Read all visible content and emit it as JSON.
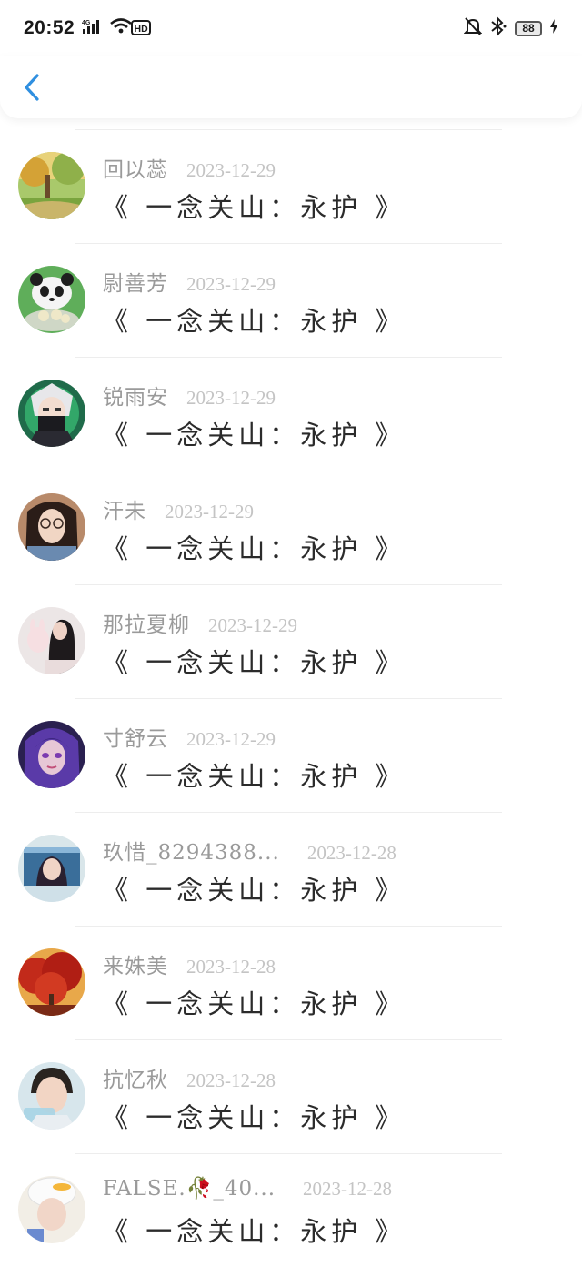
{
  "status_bar": {
    "time": "20:52",
    "network": "4G",
    "hd": "HD",
    "battery": "88"
  },
  "header": {
    "back_icon": "chevron-left-icon",
    "accent_color": "#2f8fe0"
  },
  "list": {
    "items": [
      {
        "name": "回以蕊",
        "date": "2023-12-29",
        "title": "《 一念关山：永护 》",
        "avatar": "landscape-avatar"
      },
      {
        "name": "尉善芳",
        "date": "2023-12-29",
        "title": "《 一念关山：永护 》",
        "avatar": "panda-avatar"
      },
      {
        "name": "锐雨安",
        "date": "2023-12-29",
        "title": "《 一念关山：永护 》",
        "avatar": "masked-ninja-avatar"
      },
      {
        "name": "汗未",
        "date": "2023-12-29",
        "title": "《 一念关山：永护 》",
        "avatar": "girl-glasses-avatar"
      },
      {
        "name": "那拉夏柳",
        "date": "2023-12-29",
        "title": "《 一念关山：永护 》",
        "avatar": "girl-bunny-avatar"
      },
      {
        "name": "寸舒云",
        "date": "2023-12-29",
        "title": "《 一念关山：永护 》",
        "avatar": "anime-purple-avatar"
      },
      {
        "name": "玖惜_8294388...",
        "date": "2023-12-28",
        "title": "《 一念关山：永护 》",
        "avatar": "game-character-avatar"
      },
      {
        "name": "来姝美",
        "date": "2023-12-28",
        "title": "《 一念关山：永护 》",
        "avatar": "red-tree-avatar"
      },
      {
        "name": "抗忆秋",
        "date": "2023-12-28",
        "title": "《 一念关山：永护 》",
        "avatar": "boy-photo-avatar"
      },
      {
        "name": "FALSE.🥀_40...",
        "date": "2023-12-28",
        "title": "《 一念关山：永护 》",
        "avatar": "duck-hat-avatar"
      }
    ]
  }
}
